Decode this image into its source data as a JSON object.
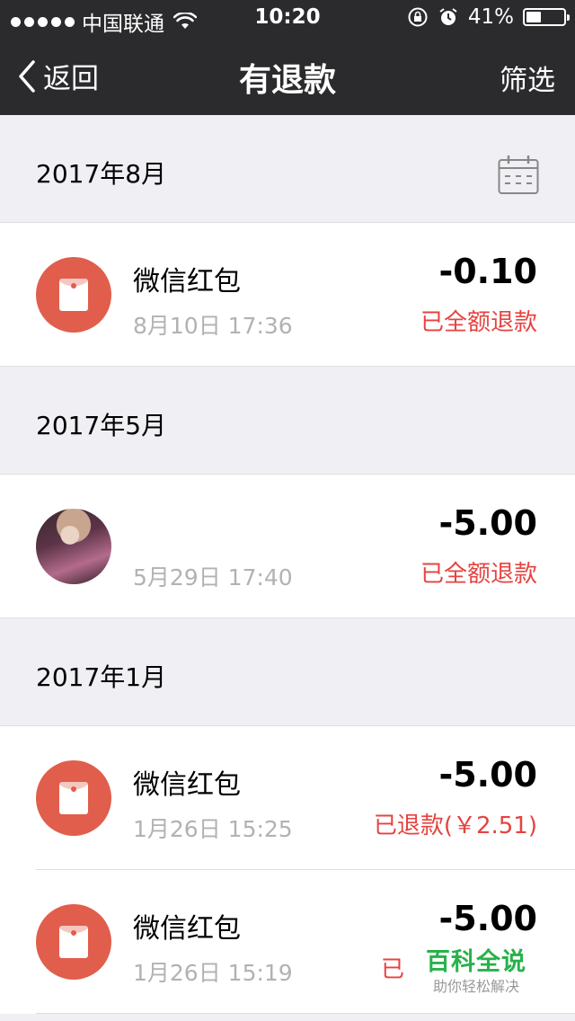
{
  "status_bar": {
    "carrier": "中国联通",
    "time": "10:20",
    "battery": "41%",
    "battery_level": 0.41
  },
  "nav": {
    "back_label": "返回",
    "title": "有退款",
    "filter_label": "筛选"
  },
  "sections": [
    {
      "month": "2017年8月",
      "items": [
        {
          "icon": "red-envelope-icon",
          "title": "微信红包",
          "date": "8月10日 17:36",
          "amount": "-0.10",
          "status": "已全额退款"
        }
      ]
    },
    {
      "month": "2017年5月",
      "items": [
        {
          "icon": "user-avatar",
          "title": "",
          "date": "5月29日 17:40",
          "amount": "-5.00",
          "status": "已全额退款"
        }
      ]
    },
    {
      "month": "2017年1月",
      "items": [
        {
          "icon": "red-envelope-icon",
          "title": "微信红包",
          "date": "1月26日 15:25",
          "amount": "-5.00",
          "status": "已退款(￥2.51)"
        },
        {
          "icon": "red-envelope-icon",
          "title": "微信红包",
          "date": "1月26日 15:19",
          "amount": "-5.00",
          "status": "已"
        }
      ]
    }
  ],
  "watermark": {
    "title": "百科全说",
    "subtitle": "助你轻松解决"
  },
  "colors": {
    "nav_bg": "#2b2b2d",
    "envelope": "#e15e4c",
    "refund_status": "#e64340"
  }
}
